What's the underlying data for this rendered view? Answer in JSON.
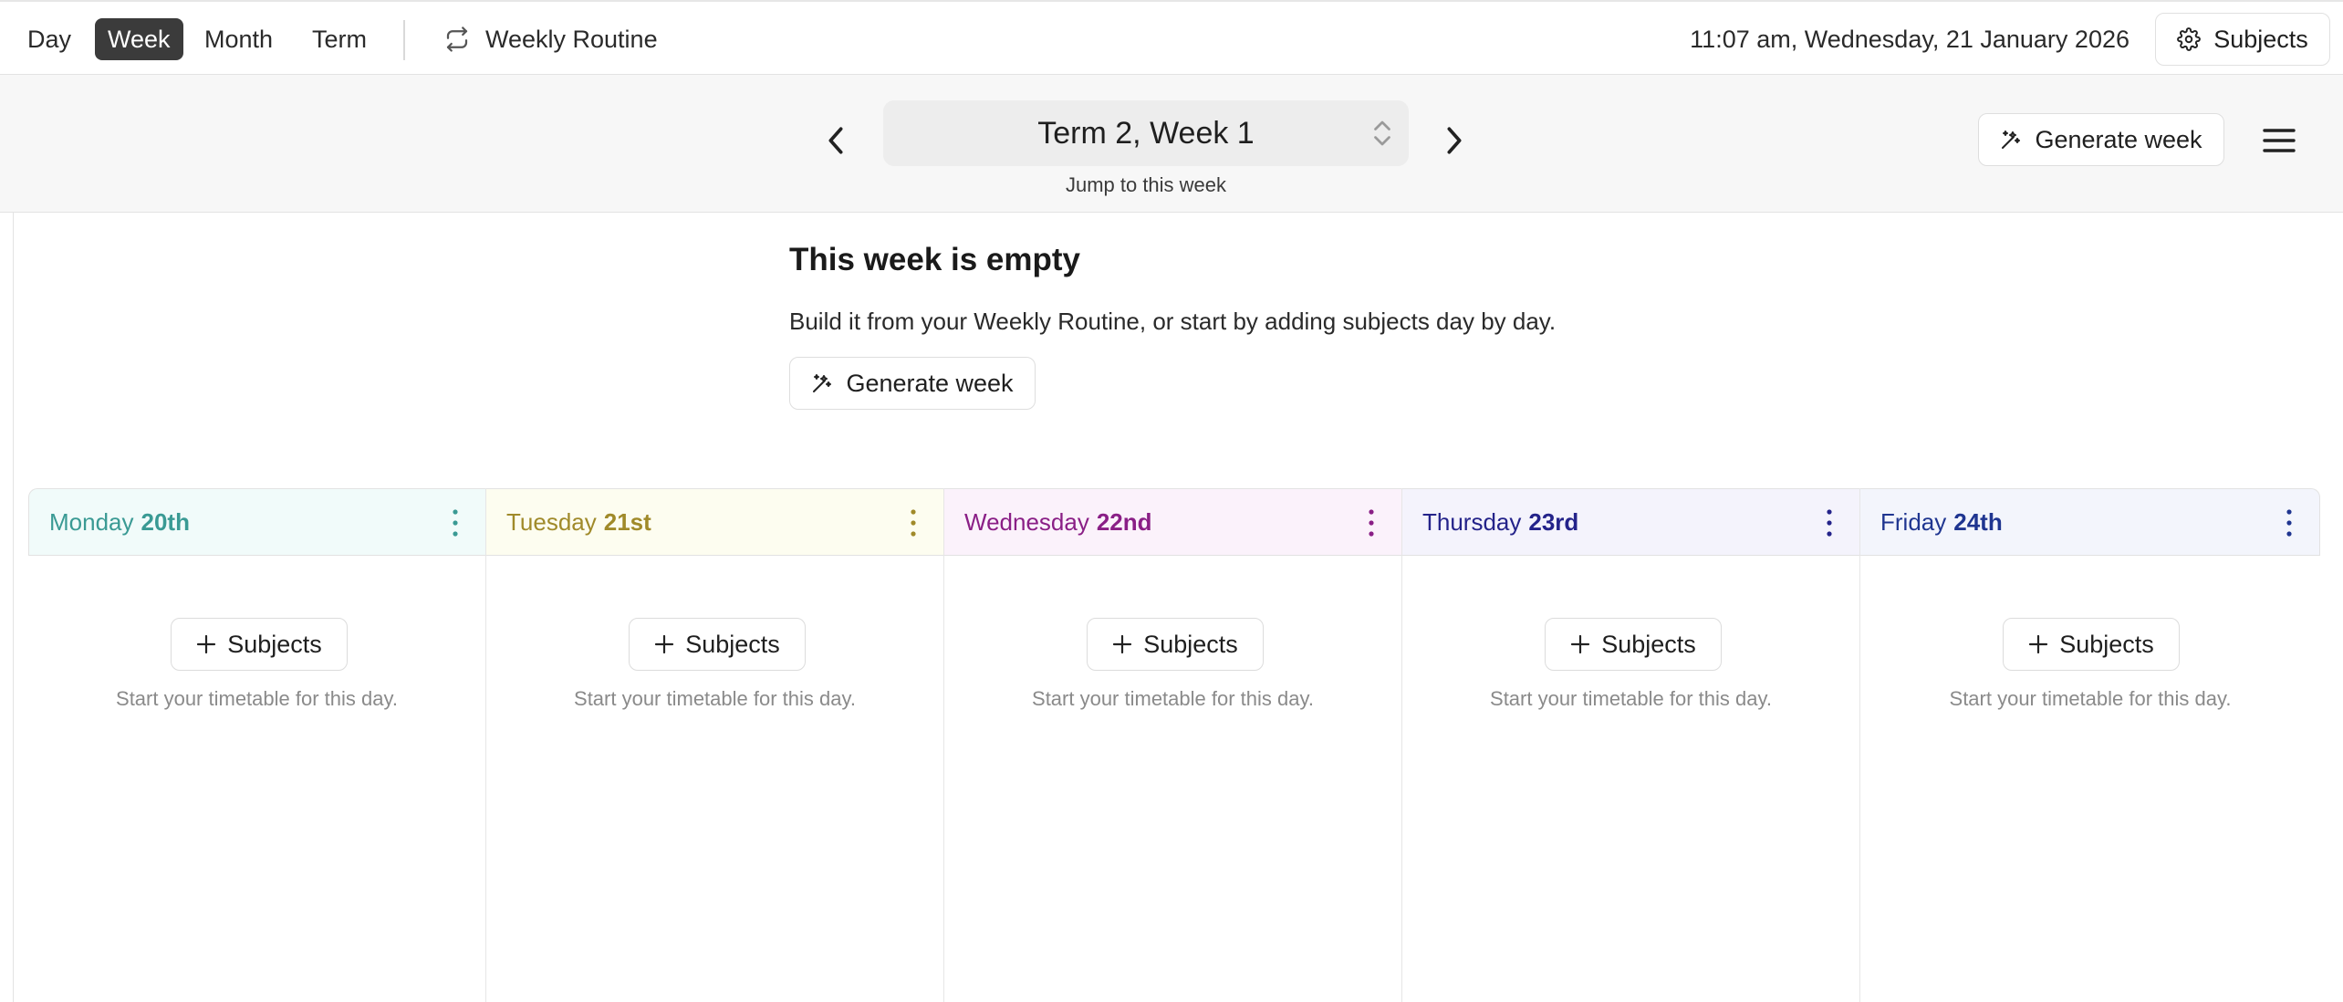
{
  "toolbar": {
    "views": [
      {
        "label": "Day",
        "active": false
      },
      {
        "label": "Week",
        "active": true
      },
      {
        "label": "Month",
        "active": false
      },
      {
        "label": "Term",
        "active": false
      }
    ],
    "routine_label": "Weekly Routine",
    "datetime": "11:07 am, Wednesday, 21 January 2026",
    "subjects_label": "Subjects"
  },
  "navigation": {
    "week_label": "Term 2, Week 1",
    "jump_label": "Jump to this week",
    "generate_label": "Generate week"
  },
  "empty_state": {
    "title": "This week is empty",
    "description": "Build it from your Weekly Routine, or start by adding subjects day by day.",
    "generate_label": "Generate week"
  },
  "days": [
    {
      "name": "Monday",
      "date": "20th",
      "color": "#3a9a94",
      "bg": "#f1fbfa",
      "add_label": "Subjects",
      "hint": "Start your timetable for this day."
    },
    {
      "name": "Tuesday",
      "date": "21st",
      "color": "#a08a2a",
      "bg": "#fdfdf0",
      "add_label": "Subjects",
      "hint": "Start your timetable for this day."
    },
    {
      "name": "Wednesday",
      "date": "22nd",
      "color": "#8a1f86",
      "bg": "#fbf2fb",
      "add_label": "Subjects",
      "hint": "Start your timetable for this day."
    },
    {
      "name": "Thursday",
      "date": "23rd",
      "color": "#24238a",
      "bg": "#f4f3fc",
      "add_label": "Subjects",
      "hint": "Start your timetable for this day."
    },
    {
      "name": "Friday",
      "date": "24th",
      "color": "#1f3590",
      "bg": "#f3f5fc",
      "add_label": "Subjects",
      "hint": "Start your timetable for this day."
    }
  ],
  "icons": {
    "routine": "repeat-icon",
    "settings": "gear-icon",
    "prev": "chevron-left-icon",
    "next": "chevron-right-icon",
    "generate": "magic-wand-icon",
    "menu": "hamburger-icon",
    "day_menu": "kebab-icon",
    "add": "plus-icon"
  }
}
